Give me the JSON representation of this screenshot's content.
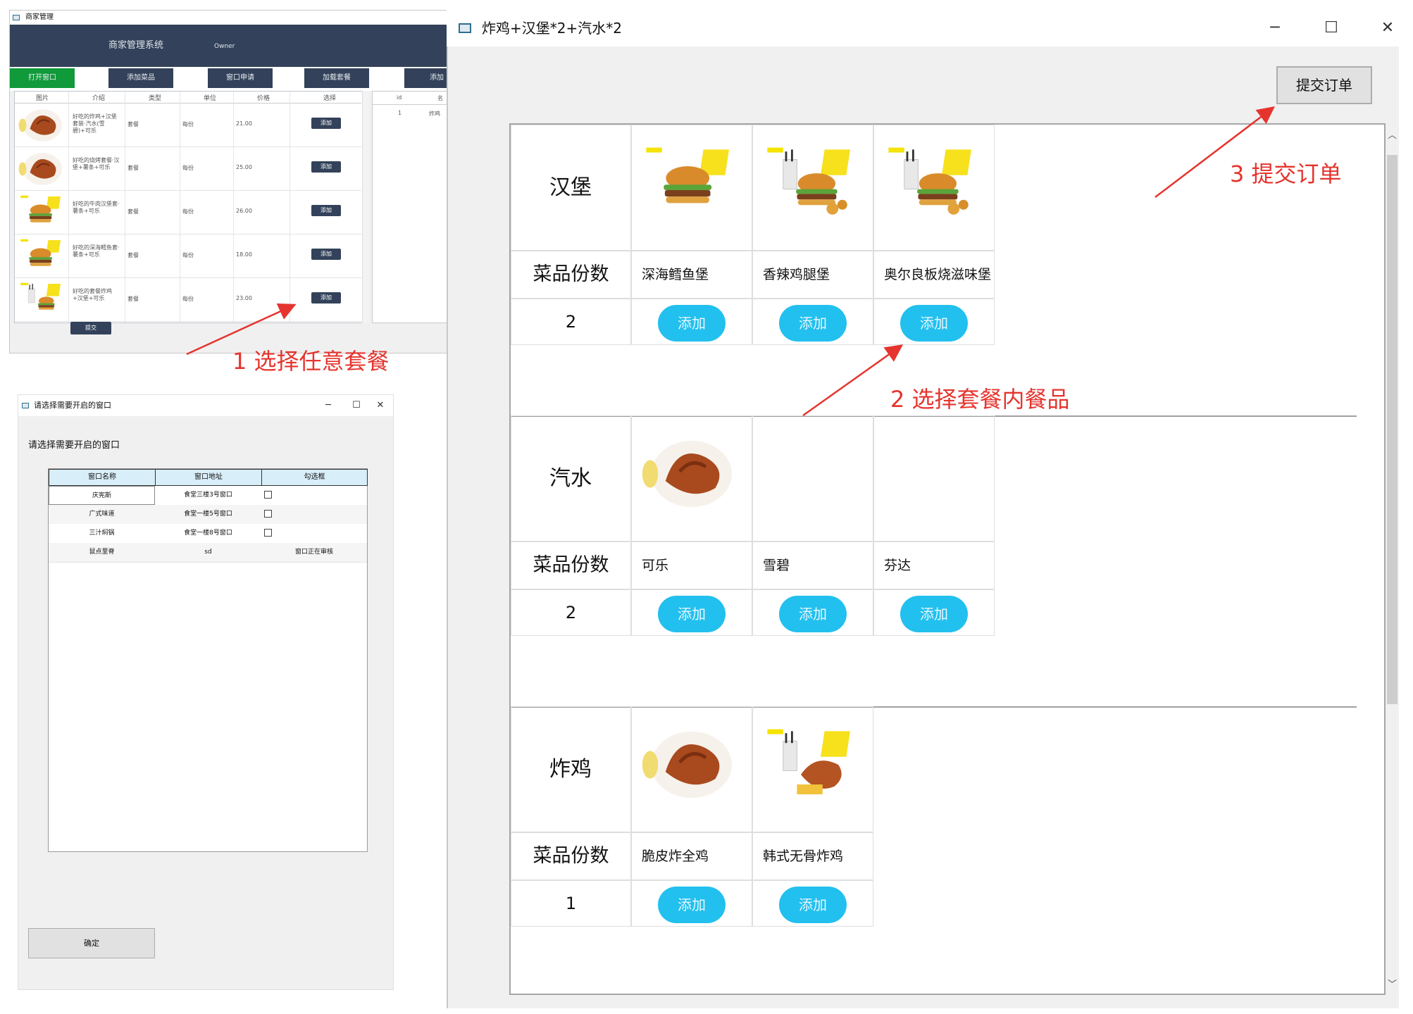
{
  "colors": {
    "annotation": "#e5342e",
    "add_button": "#22c0ee",
    "merchant_header": "#33425a",
    "active_tab": "#109a3a"
  },
  "merchant_window": {
    "title": "商家管理",
    "app_title": "商家管理系统",
    "user": "Owner",
    "tabs": [
      "打开窗口",
      "添加菜品",
      "窗口申请",
      "加载套餐",
      "添加"
    ],
    "columns": [
      "图片",
      "介绍",
      "类型",
      "单位",
      "价格",
      "选择"
    ],
    "rows": [
      {
        "desc": "好吃的炸鸡+汉堡套装·汽水(雪碧)+可乐",
        "type": "套餐",
        "unit": "每份",
        "price": "21.00",
        "btn": "添加",
        "img": "chicken"
      },
      {
        "desc": "好吃的烧烤套餐·汉堡+薯条+可乐",
        "type": "套餐",
        "unit": "每份",
        "price": "25.00",
        "btn": "添加",
        "img": "chicken"
      },
      {
        "desc": "好吃的牛肉汉堡套·薯条+可乐",
        "type": "套餐",
        "unit": "每份",
        "price": "26.00",
        "btn": "添加",
        "img": "burger"
      },
      {
        "desc": "好吃的深海鳕鱼套·薯条+可乐",
        "type": "套餐",
        "unit": "每份",
        "price": "18.00",
        "btn": "添加",
        "img": "burger"
      },
      {
        "desc": "好吃的套餐炸鸡+汉堡+可乐",
        "type": "套餐",
        "unit": "每份",
        "price": "23.00",
        "btn": "添加",
        "img": "combo"
      }
    ],
    "side_header": [
      "id",
      "名"
    ],
    "side_row": [
      "1",
      "炸鸡"
    ],
    "submit": "提交"
  },
  "picker_window": {
    "title": "请选择需要开启的窗口",
    "prompt": "请选择需要开启的窗口",
    "columns": [
      "窗口名称",
      "窗口地址",
      "勾选框"
    ],
    "rows": [
      {
        "name": "庆宪斯",
        "address": "食堂三楼3号窗口",
        "status": ""
      },
      {
        "name": "广式味道",
        "address": "食堂一楼5号窗口",
        "status": ""
      },
      {
        "name": "三汁焖锅",
        "address": "食堂一楼8号窗口",
        "status": ""
      },
      {
        "name": "鼠点里脊",
        "address": "sd",
        "status": "窗口正在审核"
      }
    ],
    "confirm": "确定"
  },
  "combo_window": {
    "title": "炸鸡+汉堡*2+汽水*2",
    "submit": "提交订单",
    "qty_label": "菜品份数",
    "add_label": "添加",
    "groups": [
      {
        "name": "汉堡",
        "qty": "2",
        "items": [
          {
            "name": "深海鳕鱼堡",
            "img": "burger"
          },
          {
            "name": "香辣鸡腿堡",
            "img": "burger-set"
          },
          {
            "name": "奥尔良板烧滋味堡",
            "img": "burger-set"
          }
        ]
      },
      {
        "name": "汽水",
        "qty": "2",
        "items": [
          {
            "name": "可乐",
            "img": "chicken"
          },
          {
            "name": "雪碧",
            "img": ""
          },
          {
            "name": "芬达",
            "img": ""
          }
        ]
      },
      {
        "name": "炸鸡",
        "qty": "1",
        "items": [
          {
            "name": "脆皮炸全鸡",
            "img": "chicken"
          },
          {
            "name": "韩式无骨炸鸡",
            "img": "chicken-set"
          }
        ]
      }
    ]
  },
  "annotations": [
    "1 选择任意套餐",
    "2 选择套餐内餐品",
    "3 提交订单"
  ]
}
